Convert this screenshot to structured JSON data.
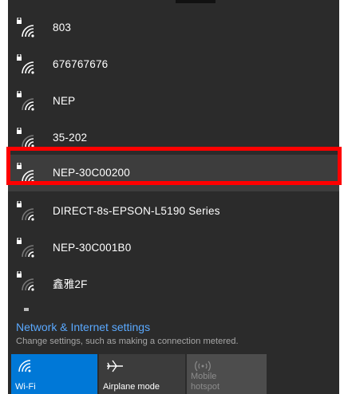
{
  "networks": [
    {
      "ssid": "803",
      "secured": true,
      "selected": false
    },
    {
      "ssid": "676767676",
      "secured": true,
      "selected": false
    },
    {
      "ssid": "NEP",
      "secured": true,
      "selected": false
    },
    {
      "ssid": "35-202",
      "secured": true,
      "selected": false
    },
    {
      "ssid": "NEP-30C00200",
      "secured": true,
      "selected": true
    },
    {
      "ssid": "DIRECT-8s-EPSON-L5190 Series",
      "secured": true,
      "selected": false
    },
    {
      "ssid": "NEP-30C001B0",
      "secured": true,
      "selected": false
    },
    {
      "ssid": "鑫雅2F",
      "secured": true,
      "selected": false
    }
  ],
  "settings": {
    "link": "Network & Internet settings",
    "description": "Change settings, such as making a connection metered."
  },
  "quick_actions": [
    {
      "label": "Wi-Fi",
      "icon": "wifi-icon",
      "state": "on"
    },
    {
      "label": "Airplane mode",
      "icon": "airplane-icon",
      "state": "off"
    },
    {
      "label": "Mobile hotspot",
      "icon": "hotspot-icon",
      "state": "disabled"
    }
  ],
  "colors": {
    "panel": "#2b2b2b",
    "accent": "#0078d7",
    "link": "#5aa9ff",
    "highlight": "#ff0000"
  }
}
